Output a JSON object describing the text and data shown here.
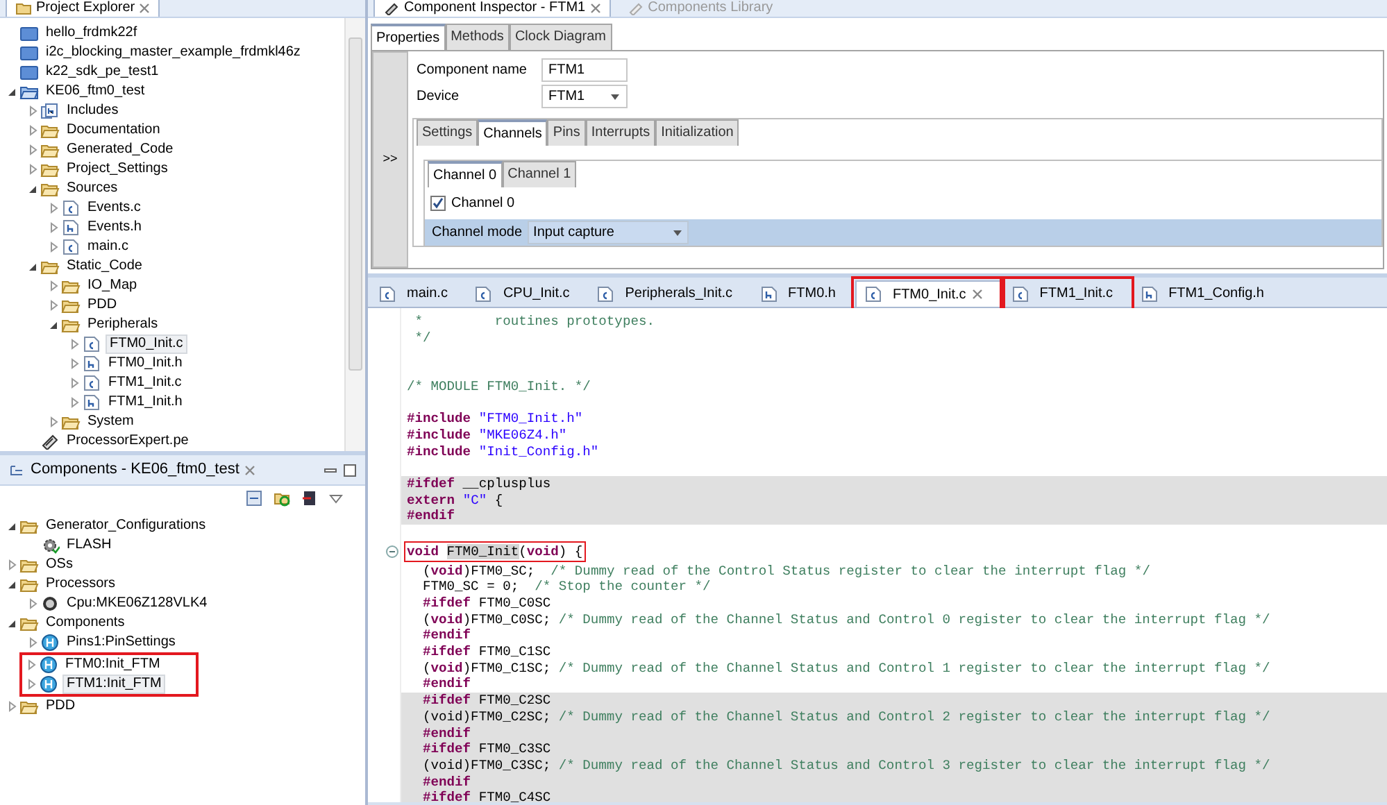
{
  "project_explorer": {
    "title": "Project Explorer",
    "items": [
      {
        "label": "hello_frdmk22f",
        "kind": "project-closed",
        "selected": false
      },
      {
        "label": "i2c_blocking_master_example_frdmkl46z",
        "kind": "project-closed",
        "selected": false
      },
      {
        "label": "k22_sdk_pe_test1",
        "kind": "project-closed",
        "selected": false
      },
      {
        "label": "KE06_ftm0_test",
        "kind": "project-open",
        "expanded": true,
        "selected": false,
        "children": [
          {
            "label": "Includes",
            "kind": "includes",
            "expanded": false,
            "selected": false
          },
          {
            "label": "Documentation",
            "kind": "folder",
            "expanded": false,
            "selected": false
          },
          {
            "label": "Generated_Code",
            "kind": "folder",
            "expanded": false,
            "selected": false
          },
          {
            "label": "Project_Settings",
            "kind": "folder",
            "expanded": false,
            "selected": false
          },
          {
            "label": "Sources",
            "kind": "folder",
            "expanded": true,
            "selected": false,
            "children": [
              {
                "label": "Events.c",
                "kind": "c-file",
                "expanded": false,
                "selected": false
              },
              {
                "label": "Events.h",
                "kind": "h-file",
                "expanded": false,
                "selected": false
              },
              {
                "label": "main.c",
                "kind": "c-file",
                "expanded": false,
                "selected": false
              }
            ]
          },
          {
            "label": "Static_Code",
            "kind": "folder",
            "expanded": true,
            "selected": false,
            "children": [
              {
                "label": "IO_Map",
                "kind": "folder",
                "expanded": false,
                "selected": false
              },
              {
                "label": "PDD",
                "kind": "folder",
                "expanded": false,
                "selected": false
              },
              {
                "label": "Peripherals",
                "kind": "folder",
                "expanded": true,
                "selected": false,
                "children": [
                  {
                    "label": "FTM0_Init.c",
                    "kind": "c-file",
                    "expanded": false,
                    "selected": true
                  },
                  {
                    "label": "FTM0_Init.h",
                    "kind": "h-file",
                    "expanded": false,
                    "selected": false
                  },
                  {
                    "label": "FTM1_Init.c",
                    "kind": "c-file",
                    "expanded": false,
                    "selected": false
                  },
                  {
                    "label": "FTM1_Init.h",
                    "kind": "h-file",
                    "expanded": false,
                    "selected": false
                  }
                ]
              },
              {
                "label": "System",
                "kind": "folder",
                "expanded": false,
                "selected": false
              }
            ]
          },
          {
            "label": "ProcessorExpert.pe",
            "kind": "pe-file",
            "selected": false
          }
        ]
      }
    ]
  },
  "components": {
    "title": "Components - KE06_ftm0_test",
    "items": [
      {
        "label": "Generator_Configurations",
        "kind": "folder",
        "expanded": true,
        "selected": false,
        "children": [
          {
            "label": "FLASH",
            "kind": "gear",
            "selected": false
          }
        ]
      },
      {
        "label": "OSs",
        "kind": "folder",
        "expanded": false,
        "selected": false
      },
      {
        "label": "Processors",
        "kind": "folder",
        "expanded": true,
        "selected": false,
        "children": [
          {
            "label": "Cpu:MKE06Z128VLK4",
            "kind": "cpu",
            "expanded": false,
            "selected": false
          }
        ]
      },
      {
        "label": "Components",
        "kind": "folder",
        "expanded": true,
        "selected": false,
        "children": [
          {
            "label": "Pins1:PinSettings",
            "kind": "component",
            "expanded": false,
            "selected": false,
            "annotated": false
          },
          {
            "label": "FTM0:Init_FTM",
            "kind": "component",
            "expanded": false,
            "selected": false,
            "annotated": true
          },
          {
            "label": "FTM1:Init_FTM",
            "kind": "component",
            "expanded": false,
            "selected": true,
            "annotated": true
          }
        ]
      },
      {
        "label": "PDD",
        "kind": "folder",
        "expanded": false,
        "selected": false
      }
    ]
  },
  "inspector": {
    "view_tabs": [
      {
        "label": "Component Inspector - FTM1",
        "selected": true
      },
      {
        "label": "Components Library",
        "selected": false
      }
    ],
    "tabs": [
      {
        "label": "Properties",
        "selected": true
      },
      {
        "label": "Methods",
        "selected": false
      },
      {
        "label": "Clock Diagram",
        "selected": false
      }
    ],
    "toggle": ">>",
    "fields": [
      {
        "label": "Component name",
        "kind": "text",
        "value": "FTM1"
      },
      {
        "label": "Device",
        "kind": "select",
        "value": "FTM1"
      }
    ],
    "sub_tabs": [
      {
        "label": "Settings",
        "selected": false
      },
      {
        "label": "Channels",
        "selected": true
      },
      {
        "label": "Pins",
        "selected": false
      },
      {
        "label": "Interrupts",
        "selected": false
      },
      {
        "label": "Initialization",
        "selected": false
      }
    ],
    "channel_tabs": [
      {
        "label": "Channel 0",
        "selected": true
      },
      {
        "label": "Channel 1",
        "selected": false
      }
    ],
    "channel_checkbox": {
      "label": "Channel 0",
      "checked": true
    },
    "rows": [
      {
        "label": "Channel mode",
        "value": "Input capture",
        "selected": true
      }
    ]
  },
  "editor": {
    "tabs": [
      {
        "label": "main.c",
        "kind": "c-file",
        "selected": false,
        "annotated": false
      },
      {
        "label": "CPU_Init.c",
        "kind": "c-file",
        "selected": false,
        "annotated": false
      },
      {
        "label": "Peripherals_Init.c",
        "kind": "c-file",
        "selected": false,
        "annotated": false
      },
      {
        "label": "FTM0.h",
        "kind": "h-file",
        "selected": false,
        "annotated": false
      },
      {
        "label": "FTM0_Init.c",
        "kind": "c-file",
        "selected": true,
        "annotated": true
      },
      {
        "label": "FTM1_Init.c",
        "kind": "c-file",
        "selected": false,
        "annotated": true
      },
      {
        "label": "FTM1_Config.h",
        "kind": "h-file",
        "selected": false,
        "annotated": false
      }
    ],
    "lines": [
      {
        "shaded": false,
        "parts": [
          {
            "kind": "com",
            "text": " *         routines prototypes."
          }
        ]
      },
      {
        "shaded": false,
        "parts": [
          {
            "kind": "com",
            "text": " */"
          }
        ]
      },
      {
        "shaded": false
      },
      {
        "shaded": false
      },
      {
        "shaded": false,
        "parts": [
          {
            "kind": "com",
            "text": "/* MODULE FTM0_Init. */"
          }
        ]
      },
      {
        "shaded": false
      },
      {
        "shaded": false,
        "parts": [
          {
            "kind": "kw",
            "text": "#include "
          },
          {
            "kind": "str",
            "text": "\"FTM0_Init.h\""
          }
        ]
      },
      {
        "shaded": false,
        "parts": [
          {
            "kind": "kw",
            "text": "#include "
          },
          {
            "kind": "str",
            "text": "\"MKE06Z4.h\""
          }
        ]
      },
      {
        "shaded": false,
        "parts": [
          {
            "kind": "kw",
            "text": "#include "
          },
          {
            "kind": "str",
            "text": "\"Init_Config.h\""
          }
        ]
      },
      {
        "shaded": false
      },
      {
        "shaded": true,
        "parts": [
          {
            "kind": "kw",
            "text": "#ifdef"
          },
          {
            "kind": "txt",
            "text": " __cplusplus"
          }
        ]
      },
      {
        "shaded": true,
        "parts": [
          {
            "kind": "kw",
            "text": "extern "
          },
          {
            "kind": "str",
            "text": "\"C\""
          },
          {
            "kind": "txt",
            "text": " {"
          }
        ]
      },
      {
        "shaded": true,
        "parts": [
          {
            "kind": "kw",
            "text": "#endif"
          }
        ]
      },
      {
        "shaded": false
      },
      {
        "shaded": false,
        "fold": true,
        "annotated": true,
        "parts": [
          {
            "kind": "kw",
            "text": "void "
          },
          {
            "kind": "mark",
            "text": "FTM0_Init"
          },
          {
            "kind": "txt",
            "text": "("
          },
          {
            "kind": "kw",
            "text": "void"
          },
          {
            "kind": "txt",
            "text": ") {"
          }
        ]
      },
      {
        "shaded": false,
        "parts": [
          {
            "kind": "txt",
            "text": "  ("
          },
          {
            "kind": "kw",
            "text": "void"
          },
          {
            "kind": "txt",
            "text": ")FTM0_SC;  "
          },
          {
            "kind": "com",
            "text": "/* Dummy read of the Control Status register to clear the interrupt flag */"
          }
        ]
      },
      {
        "shaded": false,
        "parts": [
          {
            "kind": "txt",
            "text": "  FTM0_SC = 0;  "
          },
          {
            "kind": "com",
            "text": "/* Stop the counter */"
          }
        ]
      },
      {
        "shaded": false,
        "parts": [
          {
            "kind": "kw",
            "text": "  #ifdef"
          },
          {
            "kind": "txt",
            "text": " FTM0_C0SC"
          }
        ]
      },
      {
        "shaded": false,
        "parts": [
          {
            "kind": "txt",
            "text": "  ("
          },
          {
            "kind": "kw",
            "text": "void"
          },
          {
            "kind": "txt",
            "text": ")FTM0_C0SC; "
          },
          {
            "kind": "com",
            "text": "/* Dummy read of the Channel Status and Control 0 register to clear the interrupt flag */"
          }
        ]
      },
      {
        "shaded": false,
        "parts": [
          {
            "kind": "kw",
            "text": "  #endif"
          }
        ]
      },
      {
        "shaded": false,
        "parts": [
          {
            "kind": "kw",
            "text": "  #ifdef"
          },
          {
            "kind": "txt",
            "text": " FTM0_C1SC"
          }
        ]
      },
      {
        "shaded": false,
        "parts": [
          {
            "kind": "txt",
            "text": "  ("
          },
          {
            "kind": "kw",
            "text": "void"
          },
          {
            "kind": "txt",
            "text": ")FTM0_C1SC; "
          },
          {
            "kind": "com",
            "text": "/* Dummy read of the Channel Status and Control 1 register to clear the interrupt flag */"
          }
        ]
      },
      {
        "shaded": false,
        "parts": [
          {
            "kind": "kw",
            "text": "  #endif"
          }
        ]
      },
      {
        "shaded": true,
        "parts": [
          {
            "kind": "kw",
            "text": "  #ifdef"
          },
          {
            "kind": "txt",
            "text": " FTM0_C2SC"
          }
        ]
      },
      {
        "shaded": true,
        "parts": [
          {
            "kind": "txt",
            "text": "  (void)FTM0_C2SC; "
          },
          {
            "kind": "com",
            "text": "/* Dummy read of the Channel Status and Control 2 register to clear the interrupt flag */"
          }
        ]
      },
      {
        "shaded": true,
        "parts": [
          {
            "kind": "kw",
            "text": "  #endif"
          }
        ]
      },
      {
        "shaded": true,
        "parts": [
          {
            "kind": "kw",
            "text": "  #ifdef"
          },
          {
            "kind": "txt",
            "text": " FTM0_C3SC"
          }
        ]
      },
      {
        "shaded": true,
        "parts": [
          {
            "kind": "txt",
            "text": "  (void)FTM0_C3SC; "
          },
          {
            "kind": "com",
            "text": "/* Dummy read of the Channel Status and Control 3 register to clear the interrupt flag */"
          }
        ]
      },
      {
        "shaded": true,
        "parts": [
          {
            "kind": "kw",
            "text": "  #endif"
          }
        ]
      },
      {
        "shaded": true,
        "parts": [
          {
            "kind": "kw",
            "text": "  #ifdef"
          },
          {
            "kind": "txt",
            "text": " FTM0_C4SC"
          }
        ]
      }
    ]
  }
}
